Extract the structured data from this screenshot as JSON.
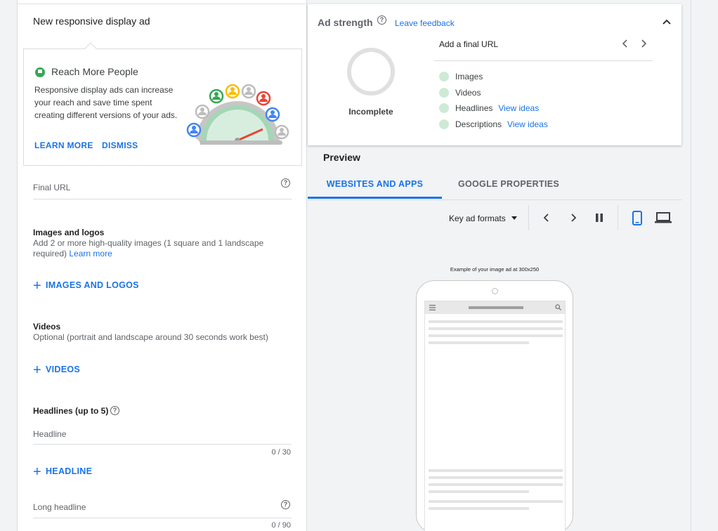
{
  "left": {
    "title": "New responsive display ad",
    "reach_card": {
      "title": "Reach More People",
      "body": "Responsive display ads can increase your reach and save time spent creating different versions of your ads.",
      "learn_more": "LEARN MORE",
      "dismiss": "DISMISS"
    },
    "final_url": {
      "placeholder": "Final URL"
    },
    "images": {
      "heading": "Images and logos",
      "description": "Add 2 or more high-quality images (1 square and 1 landscape required)",
      "learn_more": "Learn more",
      "add_label": "IMAGES AND LOGOS"
    },
    "videos": {
      "heading": "Videos",
      "description": "Optional (portrait and landscape around 30 seconds work best)",
      "add_label": "VIDEOS"
    },
    "headlines": {
      "heading": "Headlines (up to 5)",
      "placeholder": "Headline",
      "counter": "0 / 30",
      "add_label": "HEADLINE"
    },
    "long_headline": {
      "placeholder": "Long headline",
      "counter": "0 / 90"
    }
  },
  "strength": {
    "title": "Ad strength",
    "feedback": "Leave feedback",
    "status": "Incomplete",
    "prompt": "Add a final URL",
    "checklist": [
      {
        "label": "Images",
        "link": ""
      },
      {
        "label": "Videos",
        "link": ""
      },
      {
        "label": "Headlines",
        "link": "View ideas"
      },
      {
        "label": "Descriptions",
        "link": "View ideas"
      }
    ]
  },
  "preview": {
    "title": "Preview",
    "tabs": [
      "WEBSITES AND APPS",
      "GOOGLE PROPERTIES"
    ],
    "formats": "Key ad formats",
    "example_caption": "Example of your image ad at 300x250"
  },
  "colors": {
    "accent": "#1a73e8",
    "check_dot": "#ceead6",
    "flag": "#34a853"
  }
}
